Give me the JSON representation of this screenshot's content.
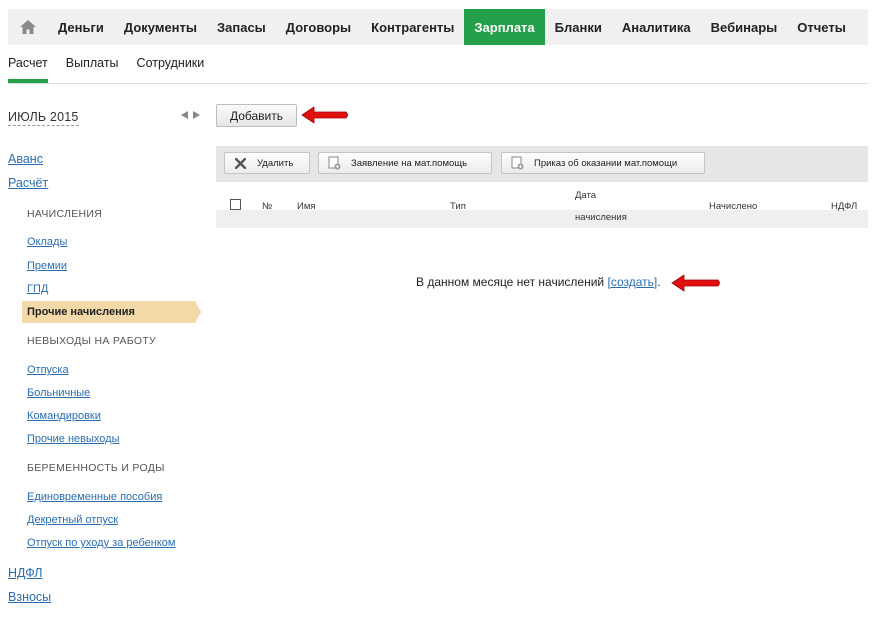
{
  "topnav": {
    "home_icon": "home-icon",
    "items": [
      {
        "label": "Деньги",
        "active": false
      },
      {
        "label": "Документы",
        "active": false
      },
      {
        "label": "Запасы",
        "active": false
      },
      {
        "label": "Договоры",
        "active": false
      },
      {
        "label": "Контрагенты",
        "active": false
      },
      {
        "label": "Зарплата",
        "active": true
      },
      {
        "label": "Бланки",
        "active": false
      },
      {
        "label": "Аналитика",
        "active": false
      },
      {
        "label": "Вебинары",
        "active": false
      },
      {
        "label": "Отчеты",
        "active": false
      }
    ],
    "active_color": "#25a04a"
  },
  "subnav": {
    "items": [
      {
        "label": "Расчет",
        "active": true
      },
      {
        "label": "Выплаты",
        "active": false
      },
      {
        "label": "Сотрудники",
        "active": false
      }
    ]
  },
  "sidebar": {
    "month": "ИЮЛЬ 2015",
    "avans": "Аванс",
    "raschet": "Расчёт",
    "section_accruals": "НАЧИСЛЕНИЯ",
    "accruals": [
      "Оклады",
      "Премии",
      "ГПД"
    ],
    "active_item": "Прочие начисления",
    "section_absence": "НЕВЫХОДЫ НА РАБОТУ",
    "absence": [
      "Отпуска",
      "Больничные",
      "Командировки",
      "Прочие невыходы"
    ],
    "section_pregnancy": "БЕРЕМЕННОСТЬ И РОДЫ",
    "pregnancy": [
      "Единовременные пособия",
      "Декретный отпуск",
      "Отпуск по уходу за ребенком"
    ],
    "ndfl": "НДФЛ",
    "vznosy": "Взносы",
    "active_color": "#f3d9a8"
  },
  "main": {
    "add_label": "Добавить",
    "toolbar": {
      "delete_label": "Удалить",
      "request_label": "Заявление на мат.помощь",
      "order_label": "Приказ об оказании мат.помощи"
    },
    "columns": {
      "number": "№",
      "name": "Имя",
      "type": "Тип",
      "date_line1": "Дата",
      "date_line2": "начисления",
      "accrued": "Начислено",
      "ndfl": "НДФЛ"
    },
    "empty_message": "В данном месяце нет начислений",
    "create_link": "[создать]",
    "empty_period": "."
  },
  "annotation_color": "#e01010"
}
